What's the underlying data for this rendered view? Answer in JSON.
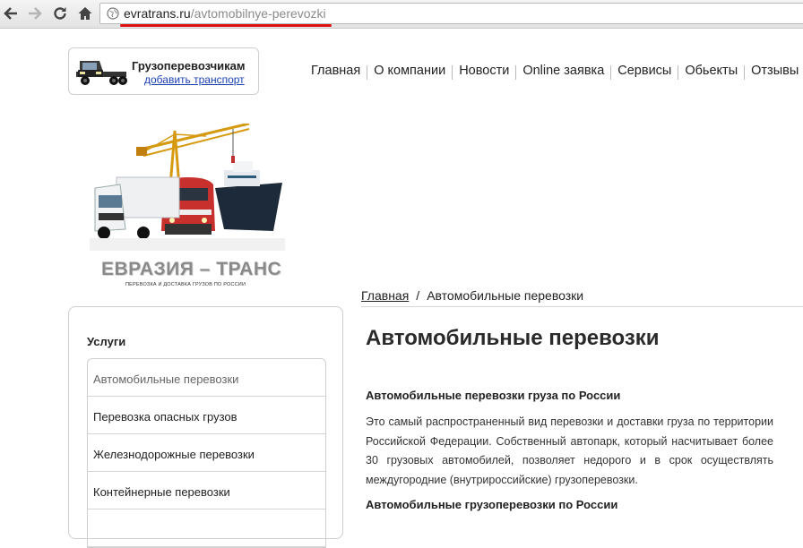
{
  "browser": {
    "url_domain": "evratrans.ru",
    "url_path": "/avtomobilnye-perevozki"
  },
  "carrier_box": {
    "title": "Грузоперевозчикам",
    "link": "добавить транспорт"
  },
  "top_menu": [
    "Главная",
    "О компании",
    "Новости",
    "Online заявка",
    "Сервисы",
    "Обьекты",
    "Отзывы"
  ],
  "logo": {
    "name": "ЕВРАЗИЯ – ТРАНС",
    "tagline": "ПЕРЕВОЗКА И ДОСТАВКА ГРУЗОВ ПО РОССИИ"
  },
  "breadcrumb": {
    "home": "Главная",
    "separator": "/",
    "current": "Автомобильные перевозки"
  },
  "sidebar": {
    "heading": "Услуги",
    "items": [
      "Автомобильные перевозки",
      "Перевозка опасных грузов",
      "Железнодорожные перевозки",
      "Контейнерные перевозки",
      ""
    ]
  },
  "content": {
    "title": "Автомобильные перевозки",
    "subheading1": "Автомобильные перевозки груза по России",
    "paragraph1": "Это самый распространенный вид перевозки и доставки груза по территории Российской Федерации. Собственный автопарк, который насчитывает более 30 грузовых автомобилей, позволяет недорого и в срок осуществлять междугородние (внутрироссийские) грузоперевозки.",
    "subheading2": "Автомобильные грузоперевозки по России"
  },
  "colors": {
    "link": "#1a3fb5",
    "url_highlight": "#e01010",
    "border": "#cfcfcf"
  }
}
